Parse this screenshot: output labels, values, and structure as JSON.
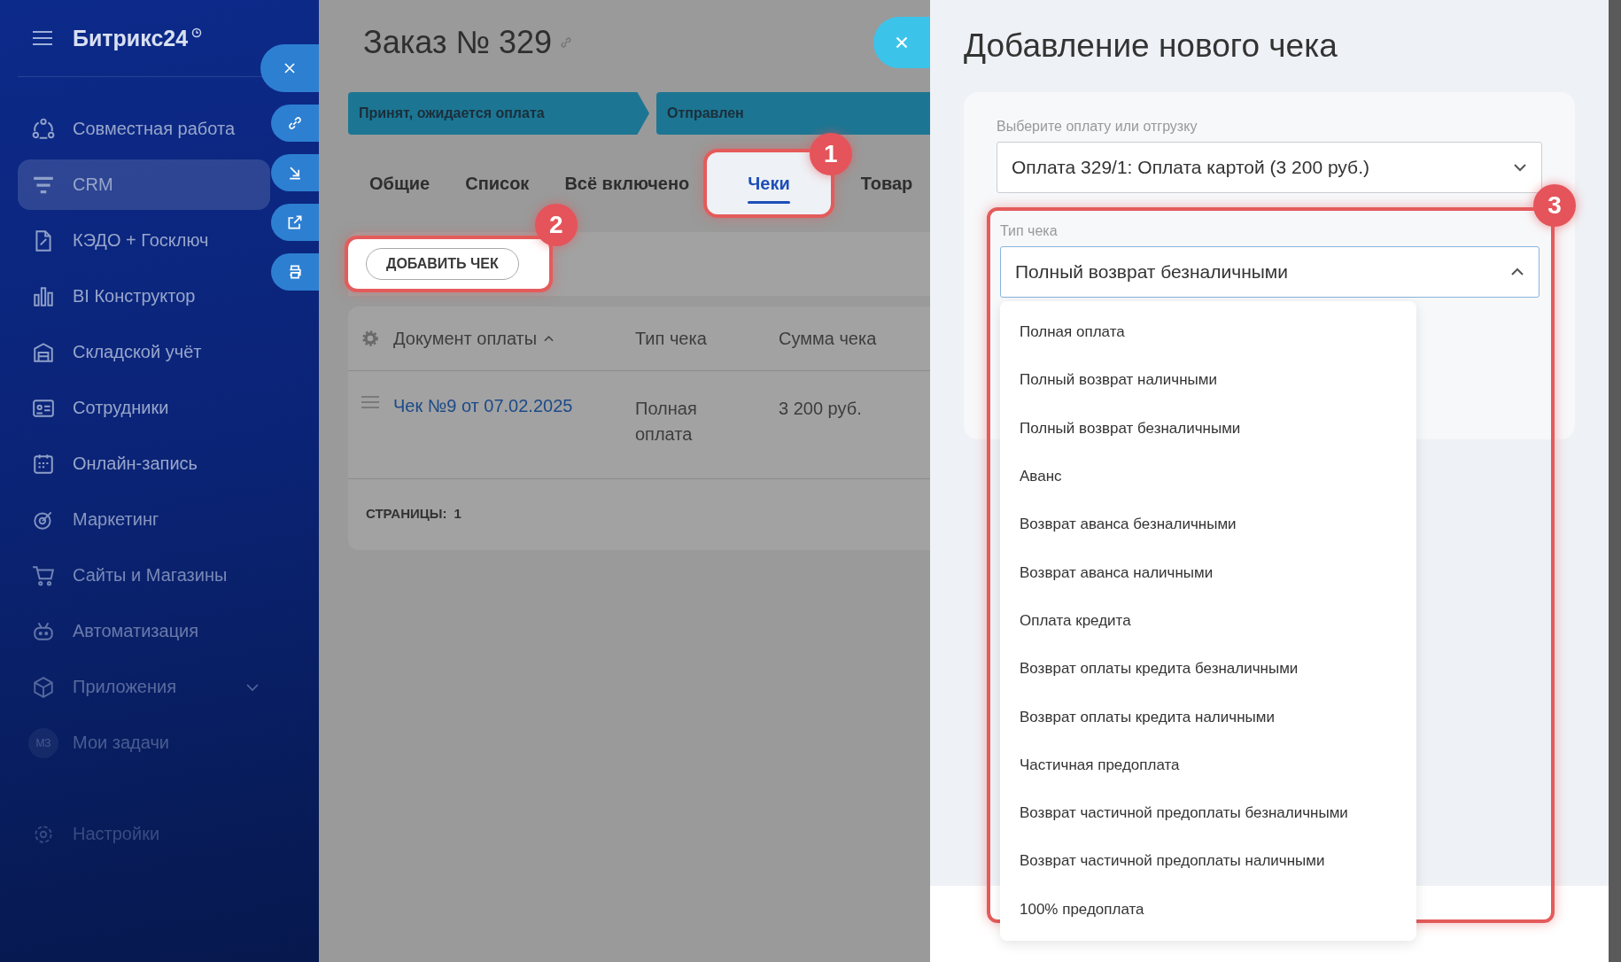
{
  "sidebar": {
    "logo": "Битрикс24",
    "items": [
      {
        "label": "Совместная работа",
        "selected": false
      },
      {
        "label": "CRM",
        "selected": true
      },
      {
        "label": "КЭДО + Госключ",
        "selected": false
      },
      {
        "label": "BI Конструктор",
        "selected": false
      },
      {
        "label": "Складской учёт",
        "selected": false
      },
      {
        "label": "Сотрудники",
        "selected": false
      },
      {
        "label": "Онлайн-запись",
        "selected": false
      },
      {
        "label": "Маркетинг",
        "selected": false
      },
      {
        "label": "Сайты и Магазины",
        "selected": false
      },
      {
        "label": "Автоматизация",
        "selected": false
      },
      {
        "label": "Приложения",
        "selected": false
      },
      {
        "label": "Мои задачи",
        "avatar": "МЗ",
        "selected": false
      },
      {
        "label": "Настройки",
        "selected": false
      }
    ]
  },
  "order": {
    "title": "Заказ № 329",
    "stages": [
      "Принят, ожидается оплата",
      "Отправлен"
    ],
    "tabs": [
      {
        "label": "Общие",
        "selected": false
      },
      {
        "label": "Список",
        "selected": false
      },
      {
        "label": "Всё включено",
        "selected": false
      },
      {
        "label": "Чеки",
        "selected": true,
        "marker": "1"
      },
      {
        "label": "Товар",
        "selected": false
      }
    ],
    "add_button": {
      "label": "ДОБАВИТЬ ЧЕК",
      "marker": "2"
    },
    "table": {
      "columns": [
        "Документ оплаты",
        "Тип чека",
        "Сумма чека"
      ],
      "rows": [
        {
          "document": "Чек №9 от 07.02.2025",
          "type": "Полная оплата",
          "sum": "3 200 руб."
        }
      ],
      "pages_label": "СТРАНИЦЫ:",
      "pages": "1"
    }
  },
  "receipt": {
    "title": "Добавление нового чека",
    "payment": {
      "label": "Выберите оплату или отгрузку",
      "value": "Оплата 329/1: Оплата картой (3 200 руб.)",
      "expanded": false
    },
    "type": {
      "label": "Тип чека",
      "value": "Полный возврат безналичными",
      "expanded": true,
      "marker": "3",
      "options": [
        "Полная оплата",
        "Полный возврат наличными",
        "Полный возврат безналичными",
        "Аванс",
        "Возврат аванса безналичными",
        "Возврат аванса наличными",
        "Оплата кредита",
        "Возврат оплаты кредита безналичными",
        "Возврат оплаты кредита наличными",
        "Частичная предоплата",
        "Возврат частичной предоплаты безналичными",
        "Возврат частичной предоплаты наличными",
        "100% предоплата"
      ]
    }
  }
}
